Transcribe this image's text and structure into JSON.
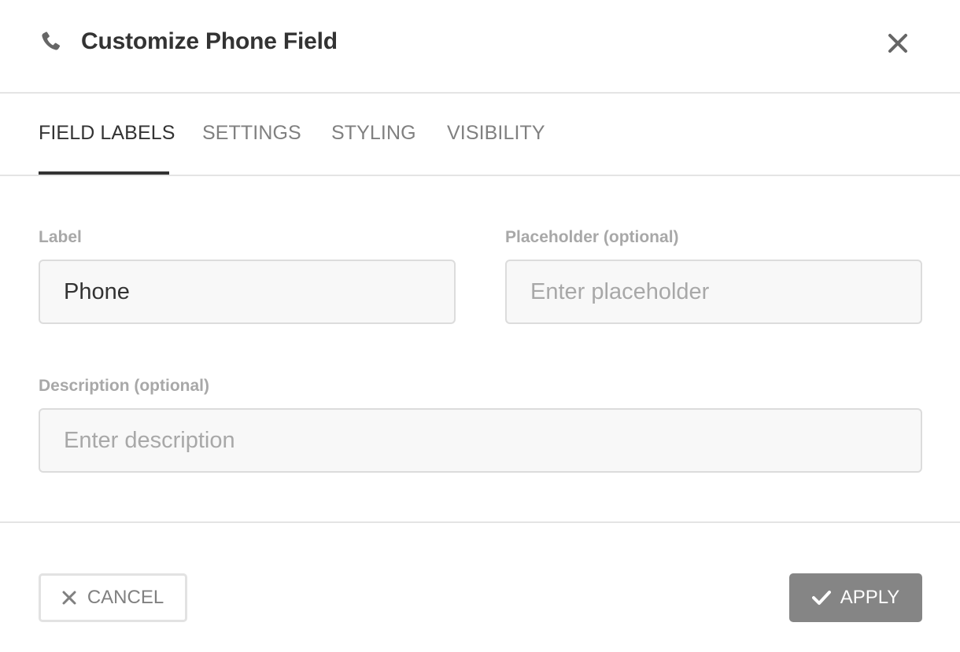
{
  "header": {
    "title": "Customize Phone Field",
    "icon": "phone-icon",
    "close_icon": "close-icon"
  },
  "tabs": [
    {
      "label": "FIELD LABELS",
      "active": true
    },
    {
      "label": "SETTINGS",
      "active": false
    },
    {
      "label": "STYLING",
      "active": false
    },
    {
      "label": "VISIBILITY",
      "active": false
    }
  ],
  "form": {
    "label": {
      "title": "Label",
      "value": "Phone",
      "placeholder": ""
    },
    "placeholder": {
      "title": "Placeholder (optional)",
      "value": "",
      "placeholder": "Enter placeholder"
    },
    "description": {
      "title": "Description (optional)",
      "value": "",
      "placeholder": "Enter description"
    }
  },
  "footer": {
    "cancel_label": "CANCEL",
    "apply_label": "APPLY"
  },
  "colors": {
    "text_dark": "#333333",
    "text_muted": "#808080",
    "label_gray": "#a8a8a8",
    "apply_bg": "#858585",
    "border": "#dcdcdc"
  }
}
